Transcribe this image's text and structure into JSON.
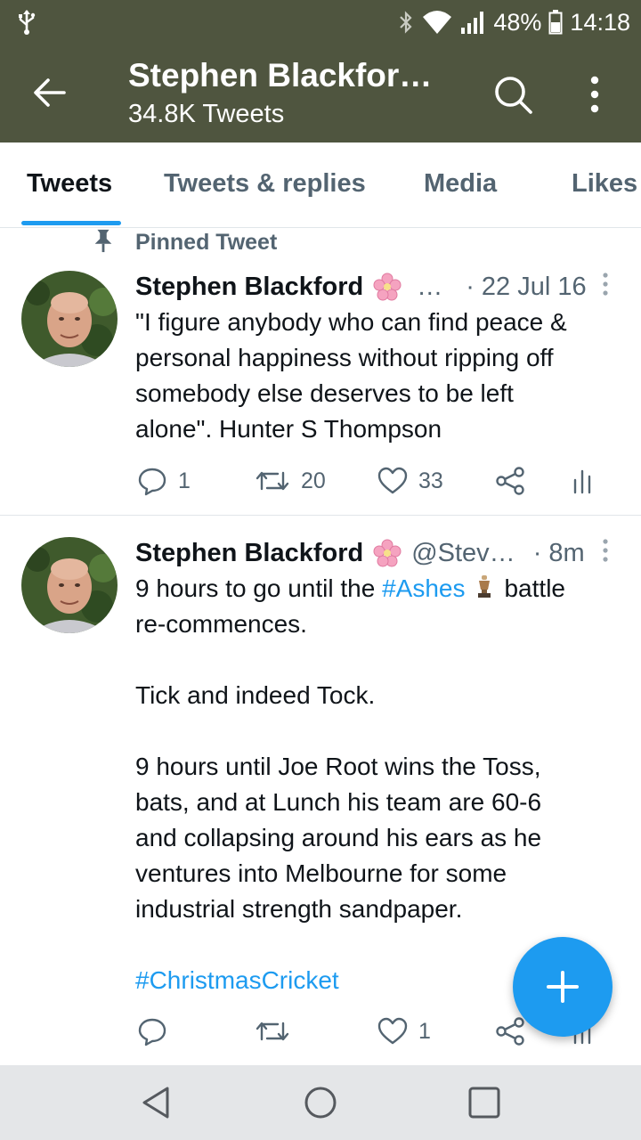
{
  "status": {
    "battery": "48%",
    "time": "14:18"
  },
  "header": {
    "title": "Stephen Blackfor…",
    "subtitle": "34.8K Tweets"
  },
  "tabs": [
    {
      "label": "Tweets",
      "active": true
    },
    {
      "label": "Tweets & replies",
      "active": false
    },
    {
      "label": "Media",
      "active": false
    },
    {
      "label": "Likes",
      "active": false
    }
  ],
  "tweets": [
    {
      "pinned_label": "Pinned Tweet",
      "name": "Stephen Blackford",
      "emoji": "cherry-blossom-icon",
      "handle": "…",
      "time": "· 22 Jul 16",
      "lines": [
        "\"I figure anybody who can find peace &",
        "personal happiness without ripping off",
        "somebody else deserves to be left",
        "alone\". Hunter S Thompson"
      ],
      "replies": "1",
      "retweets": "20",
      "likes": "33"
    },
    {
      "name": "Stephen Blackford",
      "emoji": "cherry-blossom-icon",
      "handle": "@Stev…",
      "time": "· 8m",
      "line1_pre": "9 hours to go until the ",
      "line1_tag": "#Ashes",
      "line1_post": "battle",
      "lines": [
        "re-commences.",
        "",
        "Tick and indeed Tock.",
        "",
        "9 hours until Joe Root wins the Toss,",
        "bats, and at Lunch his team are 60-6",
        "and collapsing around his ears as he",
        "ventures into Melbourne for some",
        "industrial strength sandpaper."
      ],
      "hashtag": "#ChristmasCricket",
      "replies": "",
      "retweets": "",
      "likes": "1"
    }
  ],
  "colors": {
    "header_bg": "#4f553f",
    "accent": "#1d9bf0",
    "muted": "#536471"
  }
}
